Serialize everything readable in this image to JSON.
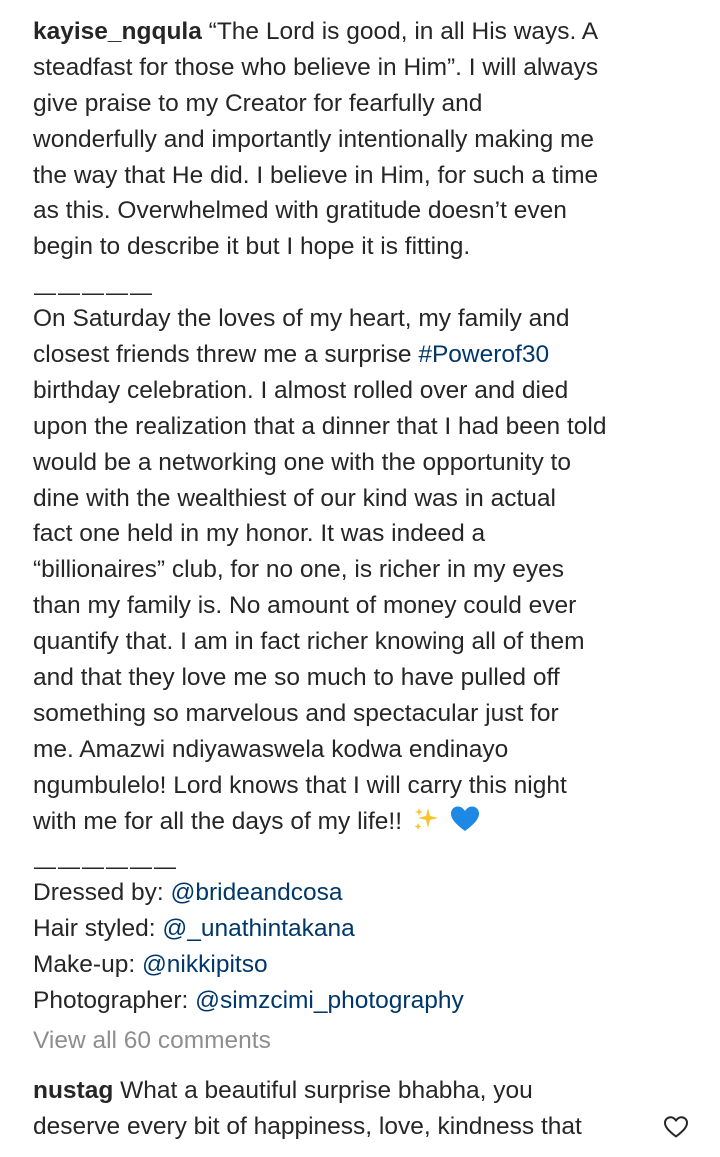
{
  "caption": {
    "username": "kayise_ngqula",
    "paragraph1": [
      "“The Lord is good, in all His ways. A",
      "steadfast for those who believe in Him”. I will always",
      "give praise to my Creator for fearfully and",
      "wonderfully and importantly intentionally making me",
      "the way that He did. I believe in Him, for such a time",
      "as this. Overwhelmed with gratitude doesn’t even",
      "begin to describe it but I hope it is fitting."
    ],
    "divider1": "—————",
    "p2_line1": "On Saturday the loves of my heart, my family and",
    "p2_line2_pre": "closest friends threw me a surprise ",
    "p2_hashtag": "#Powerof30",
    "p2_rest": [
      "birthday celebration. I almost rolled over and died",
      "upon the realization that a dinner that I had been told",
      "would be a networking one with the opportunity to",
      "dine with the wealthiest of our kind was in actual",
      "fact one held in my honor. It was indeed a",
      "“billionaires” club, for no one, is richer in my eyes",
      "than my family is. No amount of money could ever",
      "quantify that. I am in fact richer knowing all of them",
      "and that they love me so much to have pulled off",
      "something so marvelous and spectacular just for",
      "me. Amazwi ndiyawaswela kodwa endinayo",
      "ngumbulelo! Lord knows that I will carry this night"
    ],
    "p2_last": "with me for all the days of my life!!",
    "divider2": "——————",
    "credits": [
      {
        "label": "Dressed by: ",
        "handle": "@brideandcosa"
      },
      {
        "label": "Hair styled: ",
        "handle": "@_unathintakana"
      },
      {
        "label": "Make-up: ",
        "handle": "@nikkipitso"
      },
      {
        "label": "Photographer: ",
        "handle": "@simzcimi_photography"
      }
    ],
    "emojis": [
      "sparkles-icon",
      "blue-heart-icon"
    ],
    "colors": {
      "text": "#262626",
      "link": "#00376b",
      "muted": "#8e8e8e",
      "heart": "#1e88e5",
      "sparkle": "#f7c52b"
    }
  },
  "comments": {
    "view_all_label": "View all 60 comments",
    "items": [
      {
        "username": "nustag",
        "line1": "What a beautiful surprise bhabha, you",
        "line2": "deserve every bit of happiness, love, kindness that",
        "like_icon": "heart-outline-icon"
      }
    ]
  }
}
